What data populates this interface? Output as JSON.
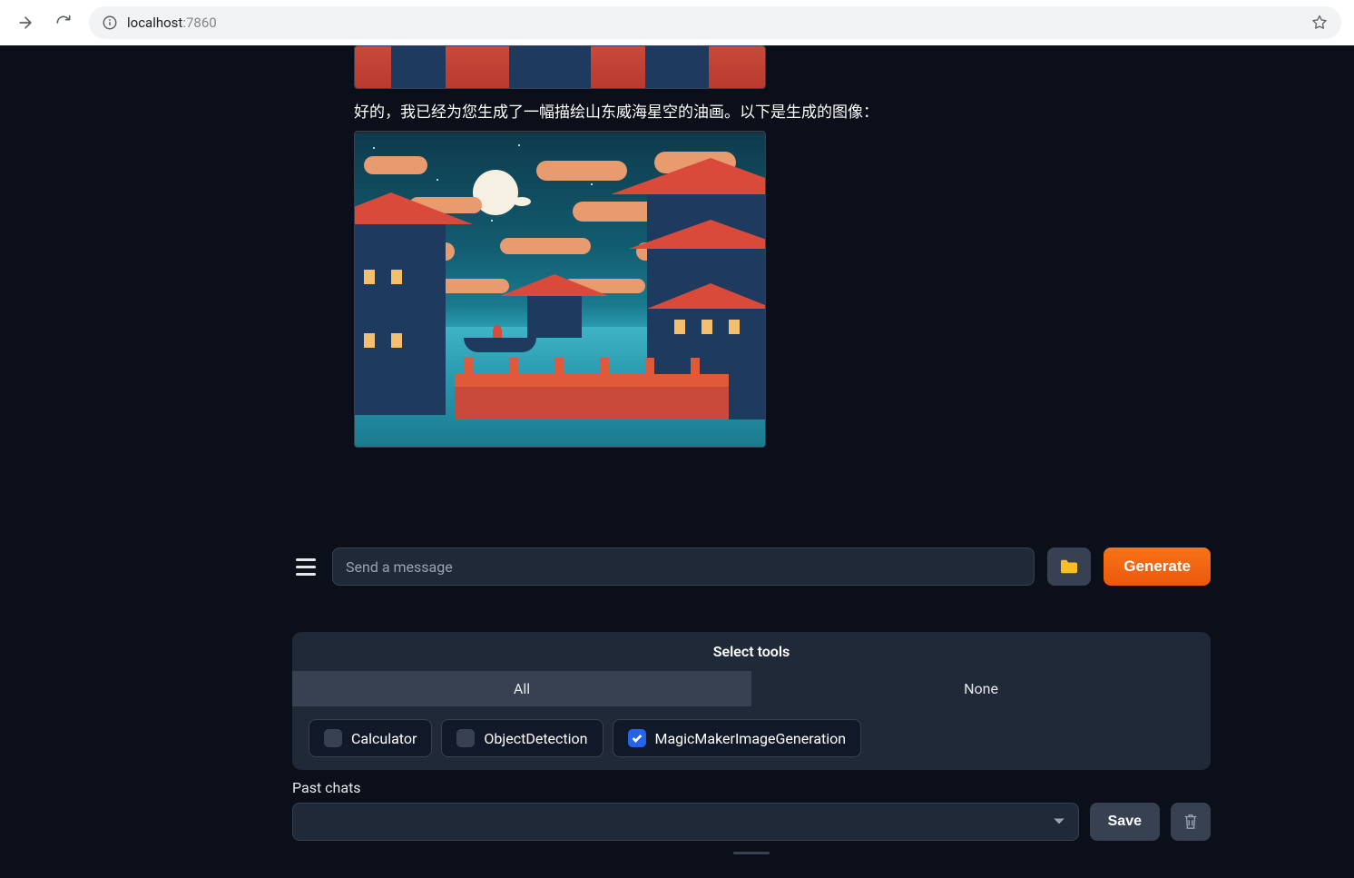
{
  "browser": {
    "url_host": "localhost",
    "url_port": ":7860"
  },
  "chat": {
    "assistant_reply": "好的，我已经为您生成了一幅描绘山东威海星空的油画。以下是生成的图像："
  },
  "input": {
    "placeholder": "Send a message",
    "generate_label": "Generate"
  },
  "tools": {
    "header": "Select tools",
    "tab_all": "All",
    "tab_none": "None",
    "items": [
      {
        "label": "Calculator",
        "checked": false
      },
      {
        "label": "ObjectDetection",
        "checked": false
      },
      {
        "label": "MagicMakerImageGeneration",
        "checked": true
      }
    ]
  },
  "past": {
    "label": "Past chats",
    "save_label": "Save"
  }
}
